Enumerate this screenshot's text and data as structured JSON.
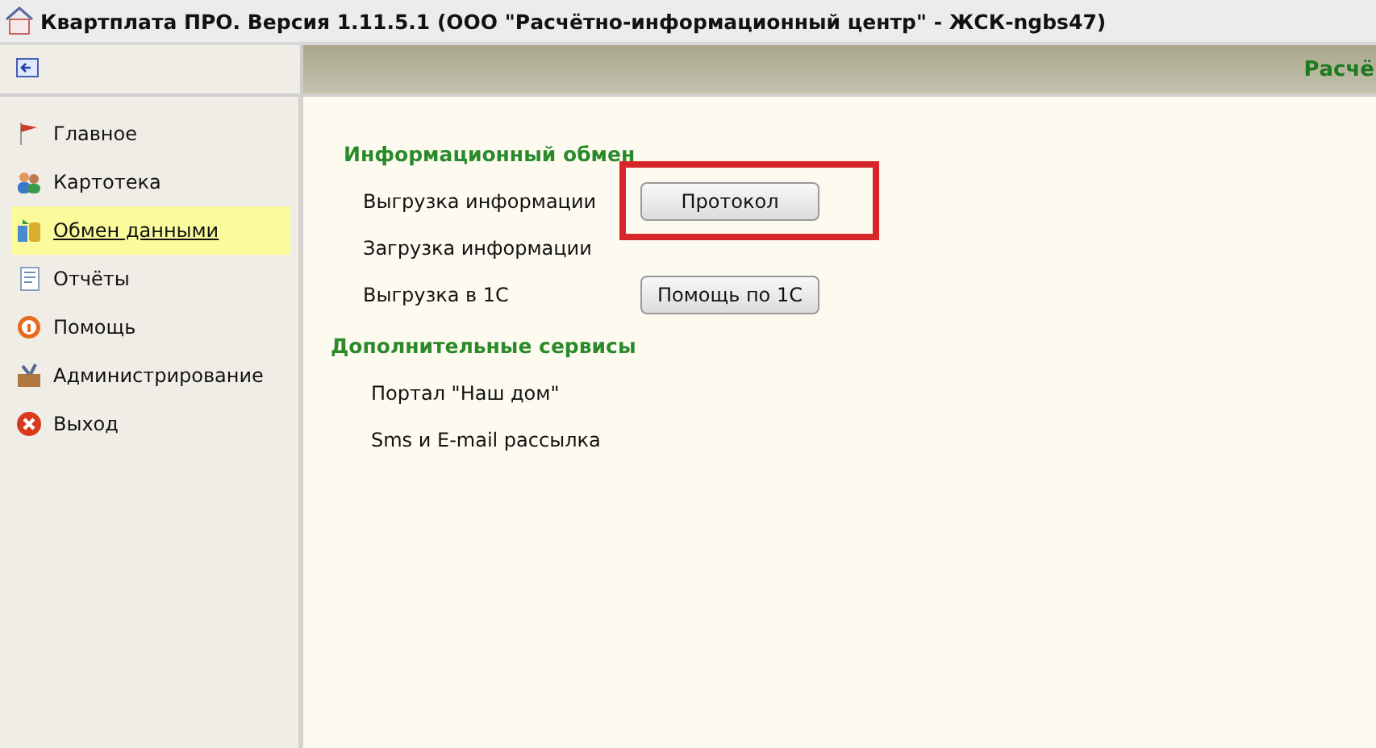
{
  "window": {
    "title": "Квартплата ПРО.  Версия 1.11.5.1 (ООО \"Расчётно-информационный центр\" - ЖСК-ngbs47)"
  },
  "header": {
    "caption": "Расчё"
  },
  "sidebar": {
    "items": [
      {
        "label": "Главное",
        "kind": "flag",
        "selected": false
      },
      {
        "label": "Картотека",
        "kind": "people",
        "selected": false
      },
      {
        "label": "Обмен данными",
        "kind": "exchange",
        "selected": true
      },
      {
        "label": "Отчёты",
        "kind": "report",
        "selected": false
      },
      {
        "label": "Помощь",
        "kind": "help",
        "selected": false
      },
      {
        "label": "Администрирование",
        "kind": "tools",
        "selected": false
      },
      {
        "label": "Выход",
        "kind": "exit",
        "selected": false
      }
    ]
  },
  "sections": [
    {
      "title": "Информационный обмен",
      "items": [
        {
          "label": "Выгрузка информации",
          "button": "Протокол",
          "highlighted": true
        },
        {
          "label": "Загрузка информации",
          "highlighted": false
        },
        {
          "label": "Выгрузка в 1С",
          "button": "Помощь по 1С",
          "highlighted": false
        }
      ]
    },
    {
      "title": "Дополнительные сервисы",
      "items": [
        {
          "label": "Портал \"Наш дом\"",
          "highlighted": false
        },
        {
          "label": "Sms и E-mail рассылка",
          "highlighted": false
        }
      ]
    }
  ]
}
